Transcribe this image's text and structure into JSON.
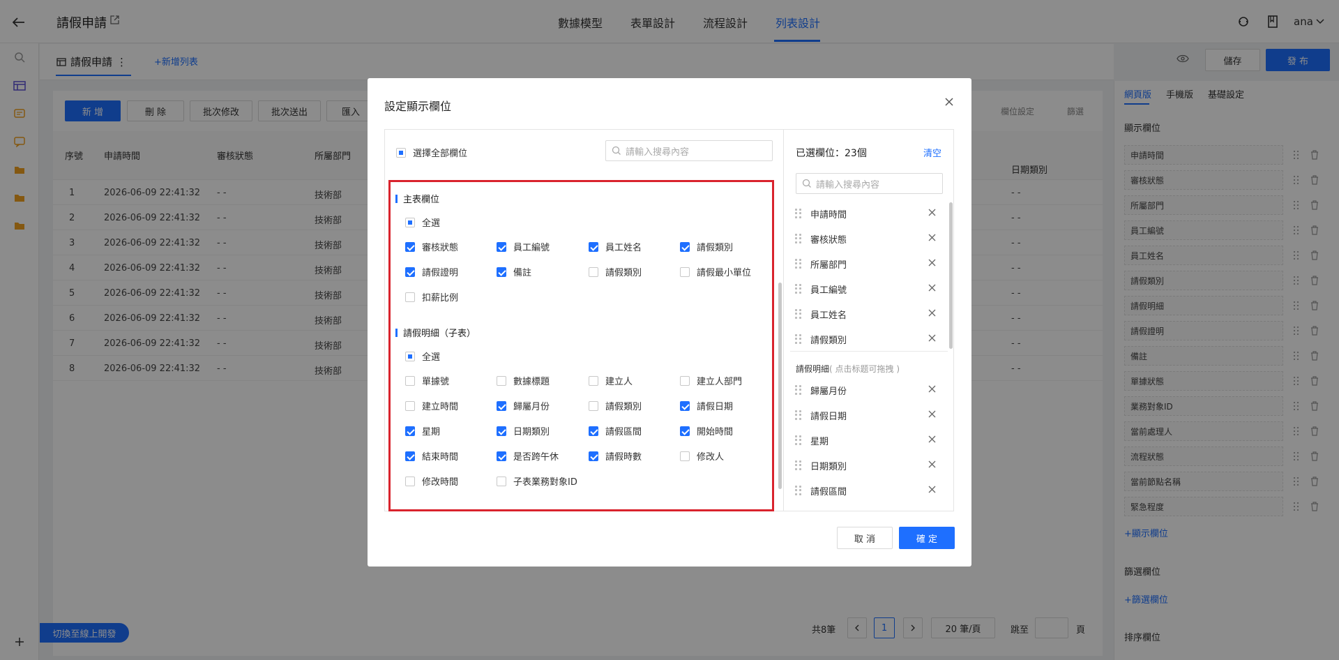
{
  "header": {
    "title": "請假申請",
    "tabs": [
      "數據模型",
      "表單設計",
      "流程設計",
      "列表設計"
    ],
    "active_tab": "列表設計",
    "user": "ana"
  },
  "listbar": {
    "tab": "請假申請",
    "add": "+新增列表",
    "preview_btn": "儲存",
    "publish_btn": "發 布"
  },
  "toolbar": {
    "buttons": [
      "新 增",
      "刪 除",
      "批次修改",
      "批次送出",
      "匯入"
    ],
    "field_settings": "欄位設定",
    "filter": "篩選"
  },
  "table": {
    "headers": [
      "序號",
      "申請時間",
      "審核狀態",
      "所屬部門"
    ],
    "extra_header": "日期類別",
    "rows": [
      [
        "1",
        "2026-06-09 22:41:32",
        "- -",
        "技術部",
        "- -"
      ],
      [
        "2",
        "2026-06-09 22:41:32",
        "- -",
        "技術部",
        "- -"
      ],
      [
        "3",
        "2026-06-09 22:41:32",
        "- -",
        "技術部",
        "- -"
      ],
      [
        "4",
        "2026-06-09 22:41:32",
        "- -",
        "技術部",
        "- -"
      ],
      [
        "5",
        "2026-06-09 22:41:32",
        "- -",
        "技術部",
        "- -"
      ],
      [
        "6",
        "2026-06-09 22:41:32",
        "- -",
        "技術部",
        "- -"
      ],
      [
        "7",
        "2026-06-09 22:41:32",
        "- -",
        "技術部",
        "- -"
      ],
      [
        "8",
        "2026-06-09 22:41:32",
        "- -",
        "技術部",
        "- -"
      ]
    ]
  },
  "pagination": {
    "total": "共8筆",
    "page": "1",
    "page_size": "20 筆/頁",
    "jump": "跳至",
    "page_unit": "頁"
  },
  "switch_btn": "切換至線上開發",
  "right_panel": {
    "tabs": [
      "網頁版",
      "手機版",
      "基礎設定"
    ],
    "display_title": "顯示欄位",
    "fields": [
      "申請時間",
      "審核狀態",
      "所屬部門",
      "員工編號",
      "員工姓名",
      "請假類別",
      "請假明細",
      "請假證明",
      "備註",
      "單據狀態",
      "業務對象ID",
      "當前處理人",
      "流程狀態",
      "當前節點名稱",
      "緊急程度"
    ],
    "add_display": "+顯示欄位",
    "filter_title": "篩選欄位",
    "add_filter": "+篩選欄位",
    "sort_title": "排序欄位"
  },
  "modal": {
    "title": "設定顯示欄位",
    "select_all_label": "選擇全部欄位",
    "search_placeholder": "請輸入搜尋內容",
    "main_section": "主表欄位",
    "all_label": "全選",
    "main_options": [
      {
        "label": "審核狀態",
        "checked": true
      },
      {
        "label": "員工編號",
        "checked": true
      },
      {
        "label": "員工姓名",
        "checked": true
      },
      {
        "label": "請假類別",
        "checked": true
      },
      {
        "label": "請假證明",
        "checked": true
      },
      {
        "label": "備註",
        "checked": true
      },
      {
        "label": "請假類別",
        "checked": false
      },
      {
        "label": "請假最小單位",
        "checked": false
      },
      {
        "label": "扣薪比例",
        "checked": false
      }
    ],
    "sub_section": "請假明細（子表）",
    "sub_options": [
      {
        "label": "單據號",
        "checked": false
      },
      {
        "label": "數據標題",
        "checked": false
      },
      {
        "label": "建立人",
        "checked": false
      },
      {
        "label": "建立人部門",
        "checked": false
      },
      {
        "label": "建立時間",
        "checked": false
      },
      {
        "label": "歸屬月份",
        "checked": true
      },
      {
        "label": "請假類別",
        "checked": false
      },
      {
        "label": "請假日期",
        "checked": true
      },
      {
        "label": "星期",
        "checked": true
      },
      {
        "label": "日期類別",
        "checked": true
      },
      {
        "label": "請假區間",
        "checked": true
      },
      {
        "label": "開始時間",
        "checked": true
      },
      {
        "label": "結束時間",
        "checked": true
      },
      {
        "label": "是否跨午休",
        "checked": true
      },
      {
        "label": "請假時數",
        "checked": true
      },
      {
        "label": "修改人",
        "checked": false
      },
      {
        "label": "修改時間",
        "checked": false
      },
      {
        "label": "子表業務對象ID",
        "checked": false
      }
    ],
    "selected_label": "已選欄位：",
    "selected_count": "23個",
    "clear": "清空",
    "selected_main": [
      "申請時間",
      "審核狀態",
      "所屬部門",
      "員工編號",
      "員工姓名",
      "請假類別"
    ],
    "selected_sub_title": "請假明細",
    "selected_sub_hint": "( 点击标题可拖拽 )",
    "selected_sub": [
      "歸屬月份",
      "請假日期",
      "星期",
      "日期類別",
      "請假區間"
    ],
    "cancel": "取 消",
    "ok": "確 定"
  }
}
